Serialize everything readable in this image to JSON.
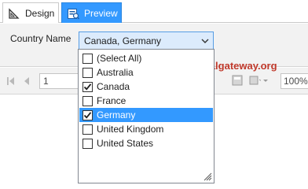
{
  "tabs": [
    {
      "label": "Design",
      "icon": "design-ruler-icon",
      "active": false
    },
    {
      "label": "Preview",
      "icon": "preview-report-icon",
      "active": true
    }
  ],
  "parameter": {
    "label": "Country Name",
    "value": "Canada, Germany",
    "options": [
      {
        "label": "(Select All)",
        "checked": false
      },
      {
        "label": "Australia",
        "checked": false
      },
      {
        "label": "Canada",
        "checked": true
      },
      {
        "label": "France",
        "checked": false
      },
      {
        "label": "Germany",
        "checked": true,
        "highlighted": true
      },
      {
        "label": "United Kingdom",
        "checked": false
      },
      {
        "label": "United States",
        "checked": false
      }
    ]
  },
  "toolbar": {
    "page_number": "1",
    "zoom": "100%"
  },
  "watermark": {
    "copyright": "©",
    "text": "tutorialgateway.org"
  },
  "colors": {
    "accent": "#3399ff",
    "combo_bg": "#dcebfc",
    "combo_border": "#569de5",
    "watermark": "#c0392b"
  }
}
